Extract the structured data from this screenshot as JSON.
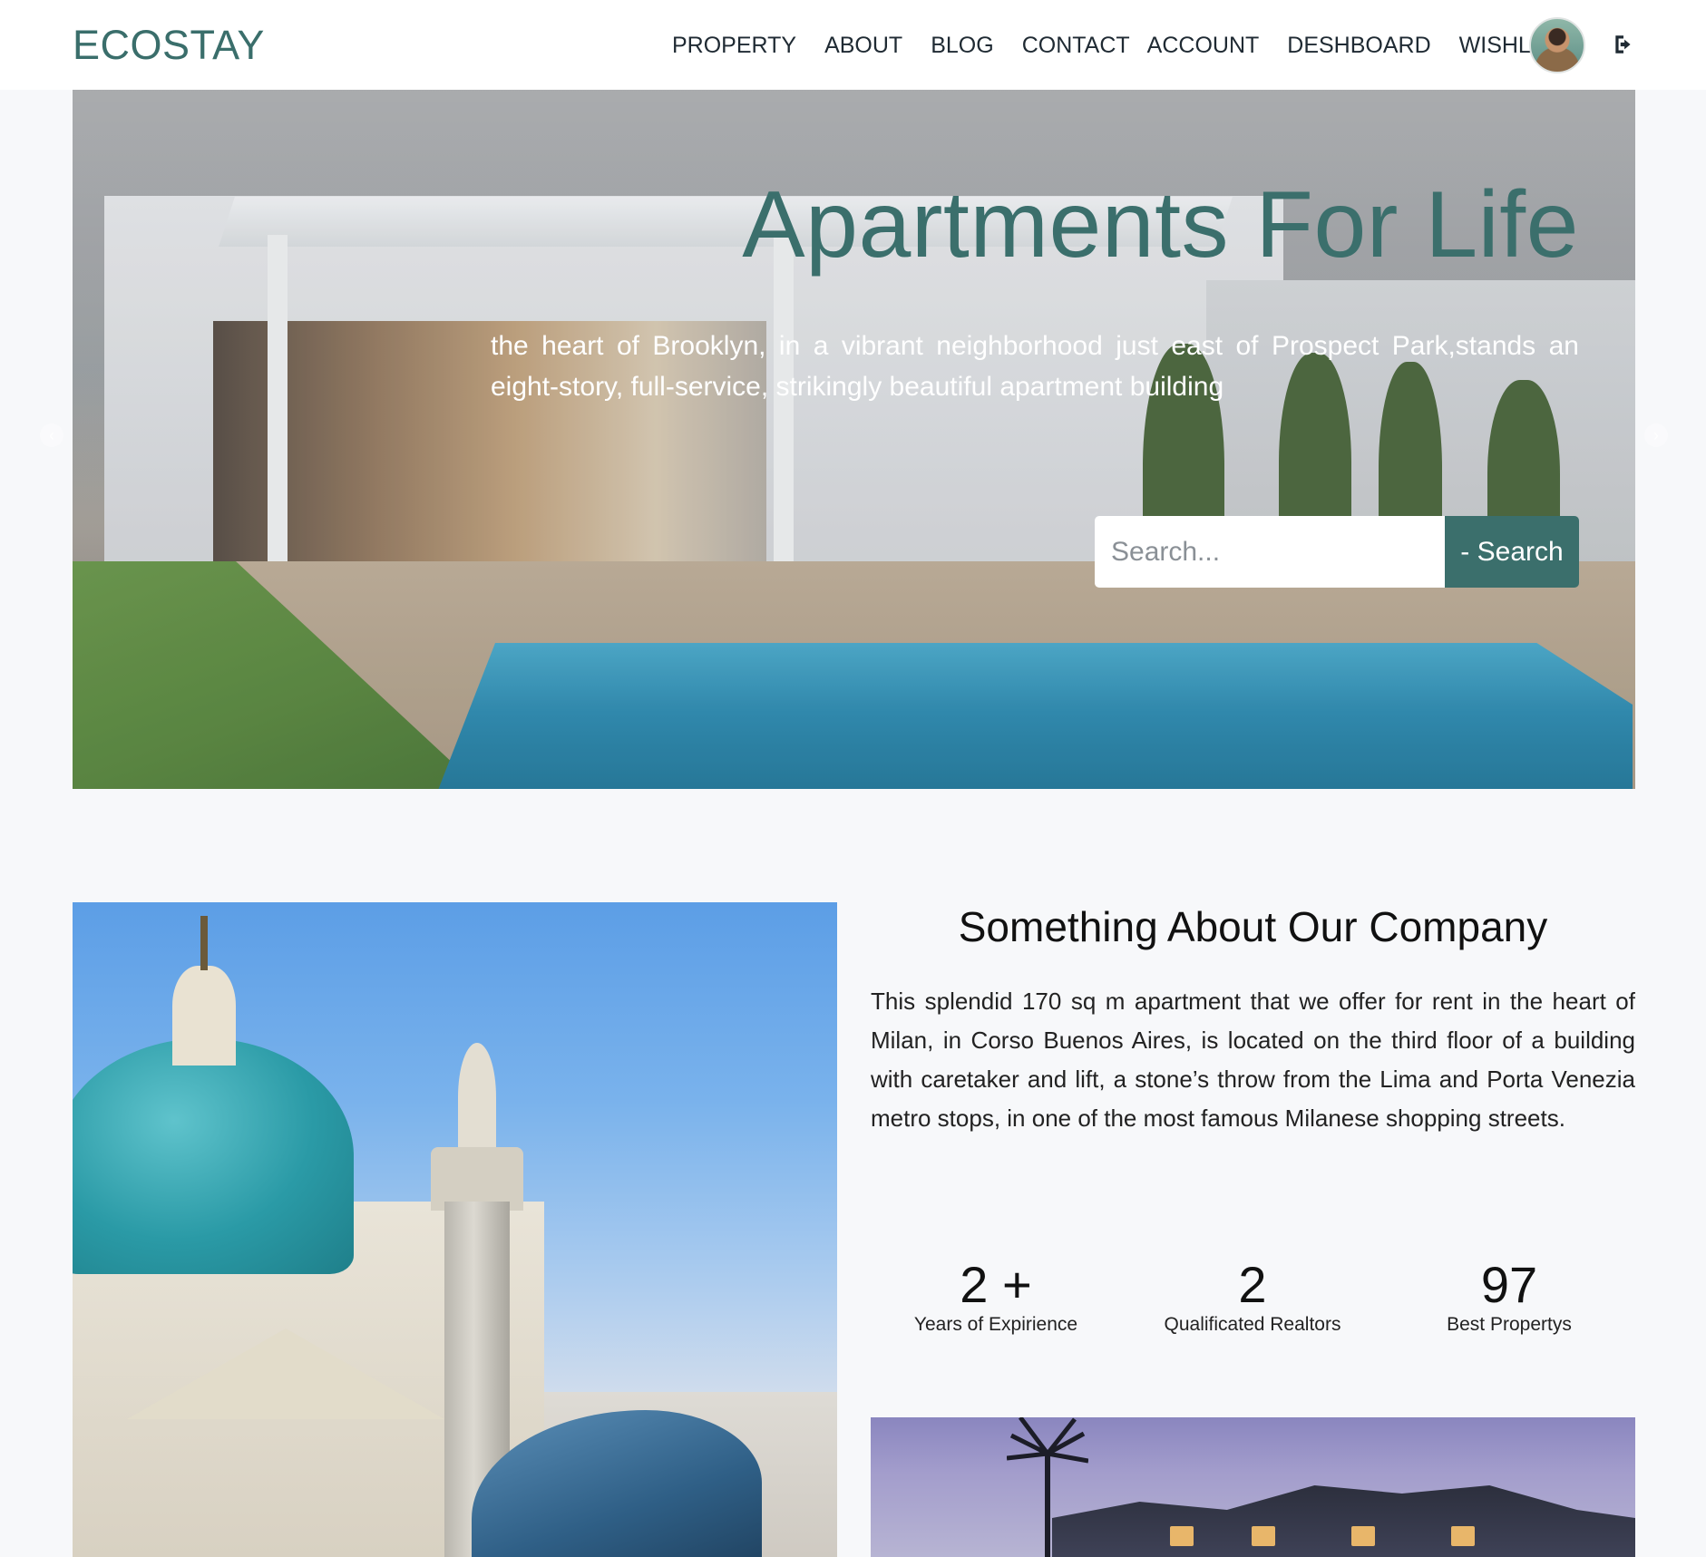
{
  "navbar": {
    "brand": "ECOSTAY",
    "links": [
      "PROPERTY",
      "ABOUT",
      "BLOG",
      "CONTACT",
      "ACCOUNT",
      "DESHBOARD",
      "WISHLIST"
    ],
    "avatar_icon": "user-avatar",
    "logout_icon": "sign-out-icon"
  },
  "hero": {
    "title": "Apartments For Life",
    "description": "the heart of Brooklyn, in a vibrant neighborhood just east of Prospect Park,stands an eight-story, full-service, strikingly beautiful apartment building",
    "search_placeholder": "Search...",
    "search_button": "- Search",
    "prev_icon": "chevron-left-icon",
    "next_icon": "chevron-right-icon"
  },
  "about": {
    "title": "Something About Our Company",
    "text": "This splendid 170 sq m apartment that we offer for rent in the heart of Milan, in Corso Buenos Aires, is located on the third floor of a building with caretaker and lift, a stone’s throw from the Lima and Porta Venezia metro stops, in one of the most famous Milanese shopping streets.",
    "stats": [
      {
        "value": "2 +",
        "label": "Years of Expirience"
      },
      {
        "value": "2",
        "label": "Qualificated Realtors"
      },
      {
        "value": "97",
        "label": "Best Propertys"
      }
    ]
  },
  "colors": {
    "brand": "#3b6f6c",
    "background": "#f7f8fa",
    "navbar": "#ffffff"
  }
}
